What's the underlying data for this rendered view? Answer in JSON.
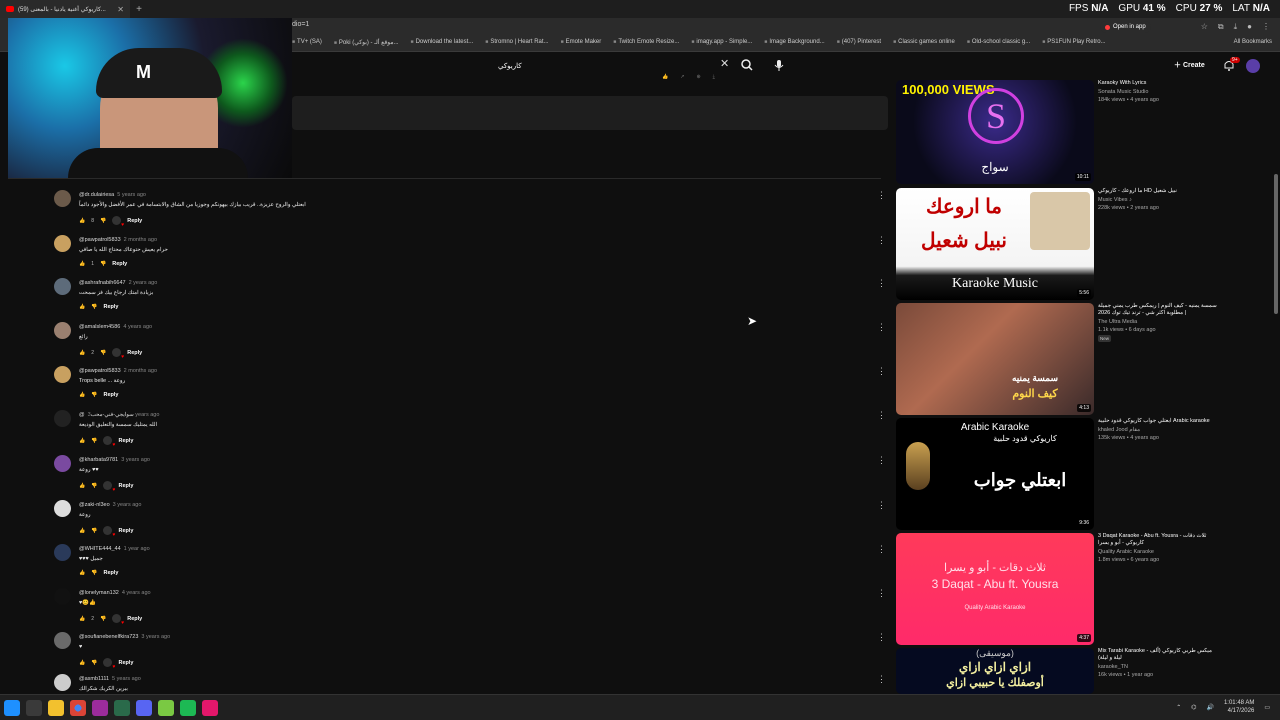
{
  "browser": {
    "tab_title": "(59) كاريوكي أغنية يادنيا - بالمعنى...",
    "url_fragment": "dio=1",
    "open_in_app": "Open in app",
    "bookmarks": [
      "TV+ (SA)",
      "Poki (بوكي) - موقع ألـ...",
      "Download the latest...",
      "Stromno | Heart Rat...",
      "Emote Maker",
      "Twitch Emote Resize...",
      "imagy.app - Simple...",
      "Image Background...",
      "(407) Pinterest",
      "Classic games online",
      "Old-school classic g...",
      "PS1FUN Play Retro..."
    ],
    "all_bookmarks": "All Bookmarks"
  },
  "stats": {
    "fps_label": "FPS",
    "fps_value": "N/A",
    "gpu_label": "GPU",
    "gpu_value": "41 %",
    "cpu_label": "CPU",
    "cpu_value": "27 %",
    "lat_label": "LAT",
    "lat_value": "N/A"
  },
  "youtube": {
    "search_value": "كاريوكي",
    "create_label": "Create",
    "notification_count": "9+"
  },
  "comments": [
    {
      "author": "@dr.dulairiesa",
      "age": "5 years ago",
      "text": "ابعتلي والروح عزيزة.. قريب بيازك بيهونكم وجوزيا من الشاق والابتسامة في عمر الأفضل والأجود دائماً",
      "likes": "8",
      "reply": "Reply"
    },
    {
      "author": "@pawpatrol5833",
      "age": "2 months ago",
      "text": "حرام يعيش حتوعاك محتاج الله يا صافي",
      "likes": "1",
      "reply": "Reply"
    },
    {
      "author": "@ashrafnabih6647",
      "age": "2 years ago",
      "text": "بزيادة امتك ارجاع بيك فز سمحت",
      "likes": "",
      "reply": "Reply"
    },
    {
      "author": "@amalslem4586",
      "age": "4 years ago",
      "text": "رائع",
      "likes": "2",
      "reply": "Reply"
    },
    {
      "author": "@pawpatrol5833",
      "age": "2 months ago",
      "text": "Trops belle ... روعة",
      "likes": "",
      "reply": "Reply"
    },
    {
      "author": "@سوايجي-فني-محب",
      "age": "3 years ago",
      "text": "الله يمتليك سمسة والتعليق الوديعة",
      "likes": "",
      "reply": "Reply"
    },
    {
      "author": "@kharbata9781",
      "age": "3 years ago",
      "text": "روعة ♥♥",
      "likes": "",
      "reply": "Reply"
    },
    {
      "author": "@zaki-nl3eo",
      "age": "3 years ago",
      "text": "روعة",
      "likes": "",
      "reply": "Reply"
    },
    {
      "author": "@WHITE444_44",
      "age": "1 year ago",
      "text": "♥♥♥ جميل",
      "likes": "",
      "reply": "Reply"
    },
    {
      "author": "@lonelyman132",
      "age": "4 years ago",
      "text": "♥😊👍",
      "likes": "2",
      "reply": "Reply"
    },
    {
      "author": "@soufianebenelfkira723",
      "age": "3 years ago",
      "text": "♥",
      "likes": "",
      "reply": "Reply"
    },
    {
      "author": "@asmb1111",
      "age": "5 years ago",
      "text": "بيرين الكريك شكرالك",
      "likes": "",
      "reply": "Reply"
    }
  ],
  "recommendations": [
    {
      "title": "Karaoky With Lyrics",
      "channel": "Sonata Music Studio",
      "views": "184k views • 4 years ago",
      "duration": "10:11",
      "thumb_main": "100,000 VIEWS",
      "thumb_sub": "سواج",
      "new": ""
    },
    {
      "title": "ما اروعك - كاريوكي HD نبيل شعيل",
      "channel": "Music Vibes ♪",
      "views": "228k views • 2 years ago",
      "duration": "5:56",
      "thumb_main": "ما اروعك",
      "thumb_sub": "نبيل شعيل",
      "thumb_extra": "Karaoke Music",
      "new": ""
    },
    {
      "title": "سمسة يمنيه - كيف النوم | ريمكس طرب يمني جميلة | مطلوبة اكثر شي - ترند تيك توك 2026",
      "channel": "The Ultra Media",
      "views": "1.1k views • 6 days ago",
      "duration": "4:13",
      "thumb_main": "سمسة يمنيه",
      "thumb_sub": "كيف النوم",
      "new": "New"
    },
    {
      "title": "ابعتلي جواب كاريوكي قدود حلبية Arabic karaoke",
      "channel": "khaled Jood مقام",
      "views": "135k views • 4 years ago",
      "duration": "9:36",
      "thumb_main": "Arabic Karaoke",
      "thumb_sub": "ابعتلي جواب",
      "thumb_extra": "كاريوكي قدود حلبية",
      "new": ""
    },
    {
      "title": "3 Daqat Karaoke - Abu ft. Yousra - ثلاث دقات كاريوكي - أبو و يسرا",
      "channel": "Quality Arabic Karaoke",
      "views": "1.8m views • 6 years ago",
      "duration": "4:37",
      "thumb_main": "ثلاث دقات - أبو و يسرا",
      "thumb_sub": "3 Daqat - Abu ft. Yousra",
      "thumb_extra": "Quality Arabic Karaoke",
      "new": ""
    },
    {
      "title": "Mix Tarabi Karaoke - ميكس طربي كاريوكي (ألف ليلة و ليلة)",
      "channel": "karaoke_TN",
      "views": "16k views • 1 year ago",
      "duration": "",
      "thumb_main": "ازاي ازاي ازاي",
      "thumb_sub": "أوصفلك يا حبيبي ازاي",
      "thumb_extra": "(موسيقى)",
      "new": ""
    }
  ],
  "taskbar": {
    "time": "1:01:48 AM",
    "date": "4/17/2026"
  },
  "colors": {
    "accent": "#ff0000",
    "bg": "#0f0f0f"
  }
}
